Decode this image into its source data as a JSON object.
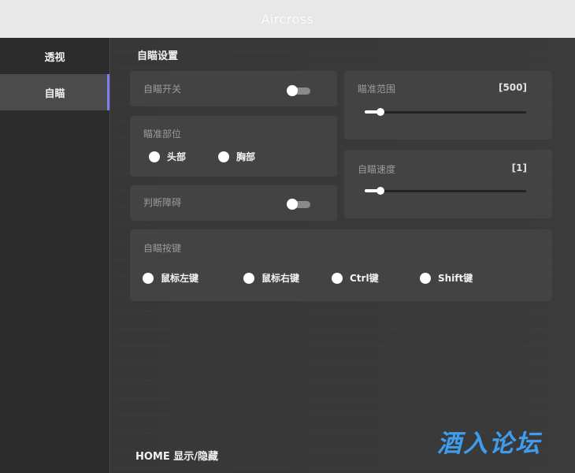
{
  "window": {
    "title": "Aircross"
  },
  "sidebar": {
    "items": [
      {
        "label": "透视",
        "active": false
      },
      {
        "label": "自瞄",
        "active": true
      }
    ]
  },
  "main": {
    "section_title": "自瞄设置",
    "aim_toggle": {
      "label": "自瞄开关",
      "on": false
    },
    "aim_part": {
      "label": "瞄准部位",
      "options": [
        "头部",
        "胸部"
      ]
    },
    "obstacle_toggle": {
      "label": "判断障碍",
      "on": false
    },
    "aim_range": {
      "label": "瞄准范围",
      "value_text": "[500]"
    },
    "aim_speed": {
      "label": "自瞄速度",
      "value_text": "[1]"
    },
    "aim_key": {
      "label": "自瞄按键",
      "options": [
        "鼠标左键",
        "鼠标右键",
        "Ctrl键",
        "Shift键"
      ]
    },
    "footer_hint": "HOME 显示/隐藏"
  },
  "watermark": "酒入论坛",
  "colors": {
    "accent": "#7d7ff0",
    "watermark": "#3f9df0",
    "sidebar_bg": "#2c2c2c",
    "card_bg": "#464646"
  }
}
